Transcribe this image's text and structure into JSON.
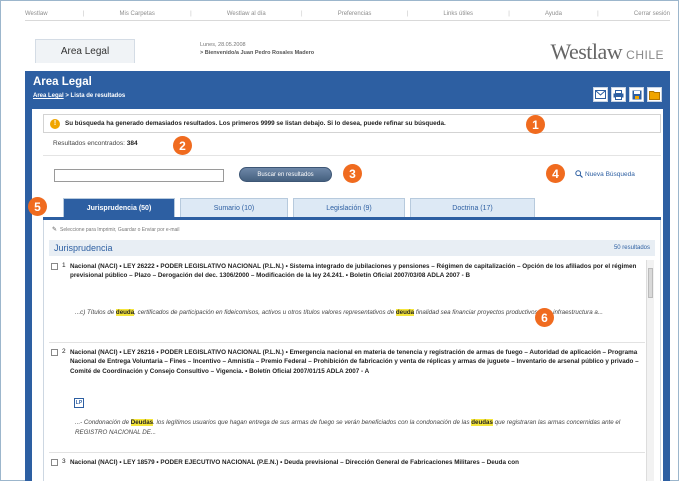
{
  "topnav": {
    "items": [
      "Westlaw",
      "Mis Carpetas",
      "Westlaw al día",
      "Preferencias",
      "Links útiles",
      "Ayuda",
      "Cerrar sesión"
    ]
  },
  "header": {
    "area_tab": "Area Legal",
    "date": "Lunes, 28.05.2008",
    "welcome": "> Bienvenido/a Juan Pedro Rosales Madero",
    "brand_main": "Westlaw",
    "brand_country": "CHILE"
  },
  "bar": {
    "title": "Area Legal",
    "crumb_link": "Area Legal",
    "crumb_rest": "> Lista de resultados"
  },
  "alert": {
    "text": "Su búsqueda ha generado demasiados resultados. Los primeros 9999 se listan debajo. Si lo desea, puede refinar su búsqueda."
  },
  "results_count": {
    "label": "Resultados encontrados:",
    "value": "384"
  },
  "search": {
    "value": "",
    "button": "Buscar en resultados",
    "new_search": "Nueva Búsqueda"
  },
  "tabs": [
    {
      "label": "Jurisprudencia (50)",
      "active": true
    },
    {
      "label": "Sumario (10)",
      "active": false
    },
    {
      "label": "Legislación (9)",
      "active": false
    },
    {
      "label": "Doctrina (17)",
      "active": false
    }
  ],
  "panel": {
    "select_hint": "Seleccione para Imprimir, Guardar o Enviar por e-mail",
    "section_title": "Jurisprudencia",
    "section_count": "50 resultados"
  },
  "results": [
    {
      "num": "1",
      "text": "Nacional (NACI) • LEY 26222 • PODER LEGISLATIVO NACIONAL (P.L.N.) • Sistema integrado de jubilaciones y pensiones – Régimen de capitalización – Opción de los afiliados por el régimen previsional público – Plazo – Derogación del dec. 1306/2000 – Modificación de la ley 24.241. • Boletín Oficial 2007/03/08 ADLA 2007 - B",
      "snip_a": "...c) Títulos de ",
      "snip_hl1": "deuda",
      "snip_b": ", certificados de participación en fideicomisos, activos u otros títulos valores representativos de ",
      "snip_hl2": "deuda",
      "snip_c": " finalidad sea financiar proyectos productivos o de infraestructura a..."
    },
    {
      "num": "2",
      "text": "Nacional (NACI) • LEY 26216 • PODER LEGISLATIVO NACIONAL (P.L.N.) • Emergencia nacional en materia de tenencia y registración de armas de fuego – Autoridad de aplicación – Programa Nacional de Entrega Voluntaria – Fines – Incentivo – Amnistía – Premio Federal – Prohibición de fabricación y venta de réplicas y armas de juguete – Inventario de arsenal público y privado – Comité de Coordinación y Consejo Consultivo – Vigencia. • Boletín Oficial 2007/01/15 ADLA 2007 - A",
      "lp": "LP",
      "snip_a": "...- Condonación de ",
      "snip_hl1": "Deudas",
      "snip_b": ". los legítimos usuarios que hagan entrega de sus armas de fuego se verán beneficiados con la condonación de las ",
      "snip_hl2": "deudas",
      "snip_c": " que registraran las armas concernidas ante el REGISTRO NACIONAL DE..."
    },
    {
      "num": "3",
      "text": "Nacional (NACI) • LEY 18579 • PODER EJECUTIVO NACIONAL (P.E.N.) • Deuda previsional – Dirección General de Fabricaciones Militares – Deuda con"
    }
  ],
  "badges": [
    "1",
    "2",
    "3",
    "4",
    "5",
    "6"
  ],
  "colors": {
    "brand_blue": "#2d5fa2",
    "callout_orange": "#f06b1f",
    "highlight": "#f6e63b"
  }
}
